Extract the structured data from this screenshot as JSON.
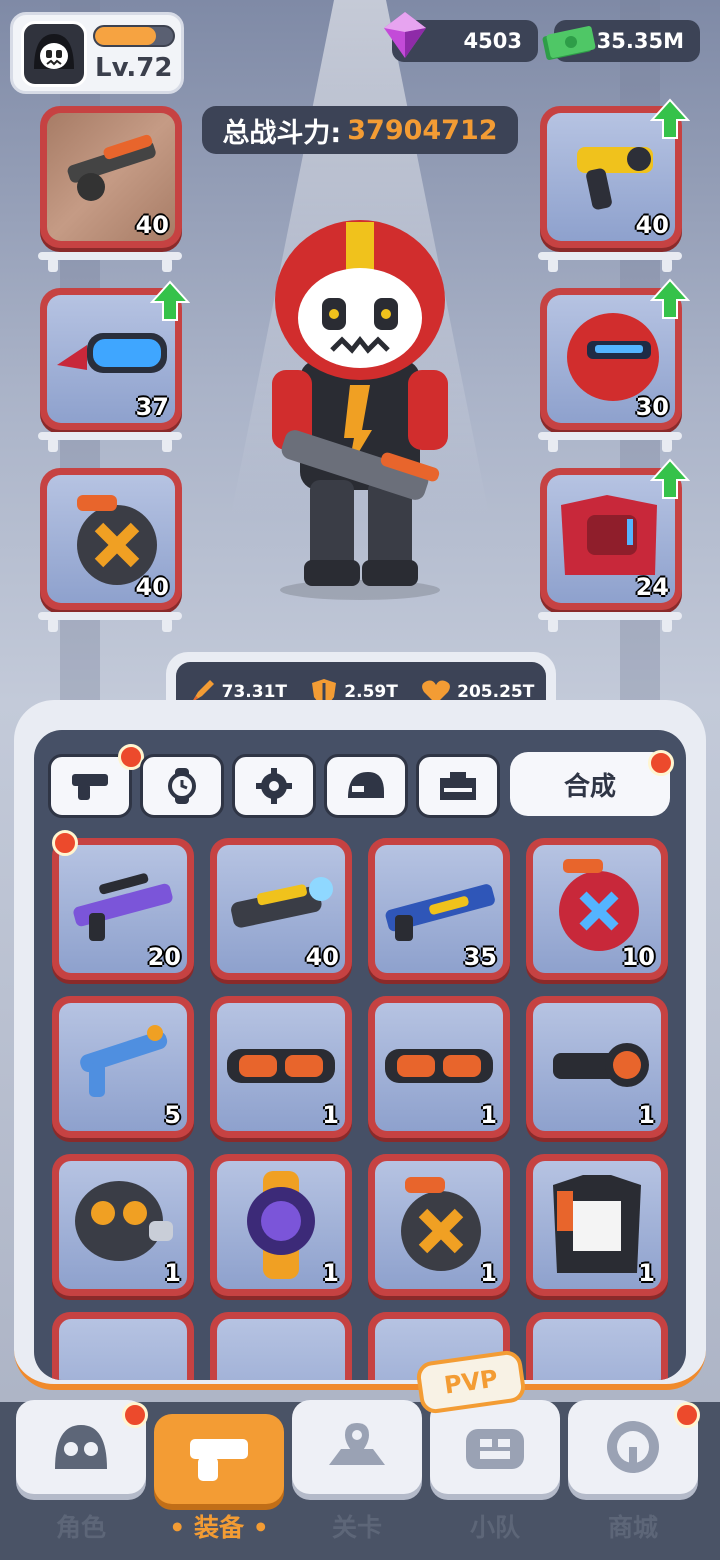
{
  "player": {
    "level_label": "Lv.72",
    "xp_progress": 0.78
  },
  "currencies": {
    "gems": "4503",
    "cash": "35.35M"
  },
  "power": {
    "label": "总战斗力:",
    "value": "37904712"
  },
  "equipped": {
    "left": [
      {
        "name": "shotgun",
        "level": "40",
        "upgrade": false
      },
      {
        "name": "goggles",
        "level": "37",
        "upgrade": true
      },
      {
        "name": "ammo-drum",
        "level": "40",
        "upgrade": false
      }
    ],
    "right": [
      {
        "name": "golden-pistol",
        "level": "40",
        "upgrade": true
      },
      {
        "name": "red-helmet",
        "level": "30",
        "upgrade": true
      },
      {
        "name": "red-armor",
        "level": "24",
        "upgrade": true
      }
    ]
  },
  "stats": {
    "attack": "73.31T",
    "defense": "2.59T",
    "health": "205.25T"
  },
  "tabs": {
    "synthesize_label": "合成"
  },
  "inventory": [
    {
      "name": "purple-rifle",
      "level": "20",
      "badge": true
    },
    {
      "name": "yellow-blaster",
      "level": "40",
      "badge": false
    },
    {
      "name": "blue-shotgun",
      "level": "35",
      "badge": false
    },
    {
      "name": "red-drum",
      "level": "10",
      "badge": false
    },
    {
      "name": "blue-revolver",
      "level": "5",
      "badge": false
    },
    {
      "name": "orange-goggles",
      "level": "1",
      "badge": false
    },
    {
      "name": "orange-goggles-2",
      "level": "1",
      "badge": false
    },
    {
      "name": "scope",
      "level": "1",
      "badge": false
    },
    {
      "name": "gas-mask",
      "level": "1",
      "badge": false
    },
    {
      "name": "purple-watch",
      "level": "1",
      "badge": false
    },
    {
      "name": "ammo-drum",
      "level": "1",
      "badge": false
    },
    {
      "name": "jacket",
      "level": "1",
      "badge": false
    }
  ],
  "nav": {
    "character": "角色",
    "equipment": "装备",
    "stage": "关卡",
    "squad": "小队",
    "shop": "商城",
    "pvp": "PVP"
  },
  "colors": {
    "accent": "#f39c34",
    "slot_red": "#c64242",
    "dark": "#3c4356"
  }
}
